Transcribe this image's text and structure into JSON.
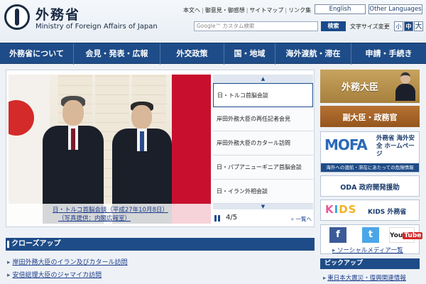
{
  "header": {
    "logo_jp": "外務省",
    "logo_en": "Ministry of Foreign Affairs of Japan",
    "util_links": [
      "本文へ",
      "御意見・御感想",
      "サイトマップ",
      "リンク集"
    ],
    "lang_en": "English",
    "lang_other": "Other Languages",
    "search_placeholder": "Google™ カスタム検索",
    "search_button": "検索",
    "font_size_label": "文字サイズ変更",
    "font_small": "小",
    "font_mid": "中",
    "font_large": "大"
  },
  "nav": {
    "items": [
      "外務省について",
      "会見・発表・広報",
      "外交政策",
      "国・地域",
      "海外渡航・滞在",
      "申請・手続き"
    ]
  },
  "slideshow": {
    "caption_line1": "日・トルコ首脳会談（平成27年10月8日）",
    "caption_line2": "（写真提供：内閣広報室）",
    "items": [
      "日・トルコ首脳会談",
      "岸田外務大臣の再任記者会見",
      "岸田外務大臣のカタール訪問",
      "日・パプアニューギニア首脳会談",
      "日・イラン外相会談"
    ],
    "active_index": 0,
    "counter": "4/5",
    "list_all": "一覧へ"
  },
  "closeup": {
    "title": "クローズアップ",
    "items": [
      "岸田外務大臣のイラン及びカタール訪問",
      "安倍総理大臣のジャマイカ訪問"
    ]
  },
  "sidebar": {
    "minister": "外務大臣",
    "vice": "副大臣・政務官",
    "mofa_logo": "MOFA",
    "mofa_title": "外務省 海外安全 ホームページ",
    "mofa_sub": "海外への渡航・滞在にあたっての危険情報",
    "oda": "ODA 政府開発援助",
    "kids_logo_k": "K",
    "kids_logo_i": "I",
    "kids_logo_ds": "DS",
    "kids_text": "KIDS 外務省",
    "facebook_glyph": "f",
    "twitter_glyph": "t",
    "youtube_you": "You",
    "youtube_tube": "Tube",
    "social_link": "ソーシャルメディア一覧",
    "pickup_title": "ピックアップ",
    "pickup_item": "東日本大震災・復興関連情報"
  },
  "colors": {
    "nav_blue": "#1e4c88",
    "link_blue": "#1a3c8a",
    "minister_gold": "#b8924c",
    "vice_brown": "#a5632a"
  }
}
